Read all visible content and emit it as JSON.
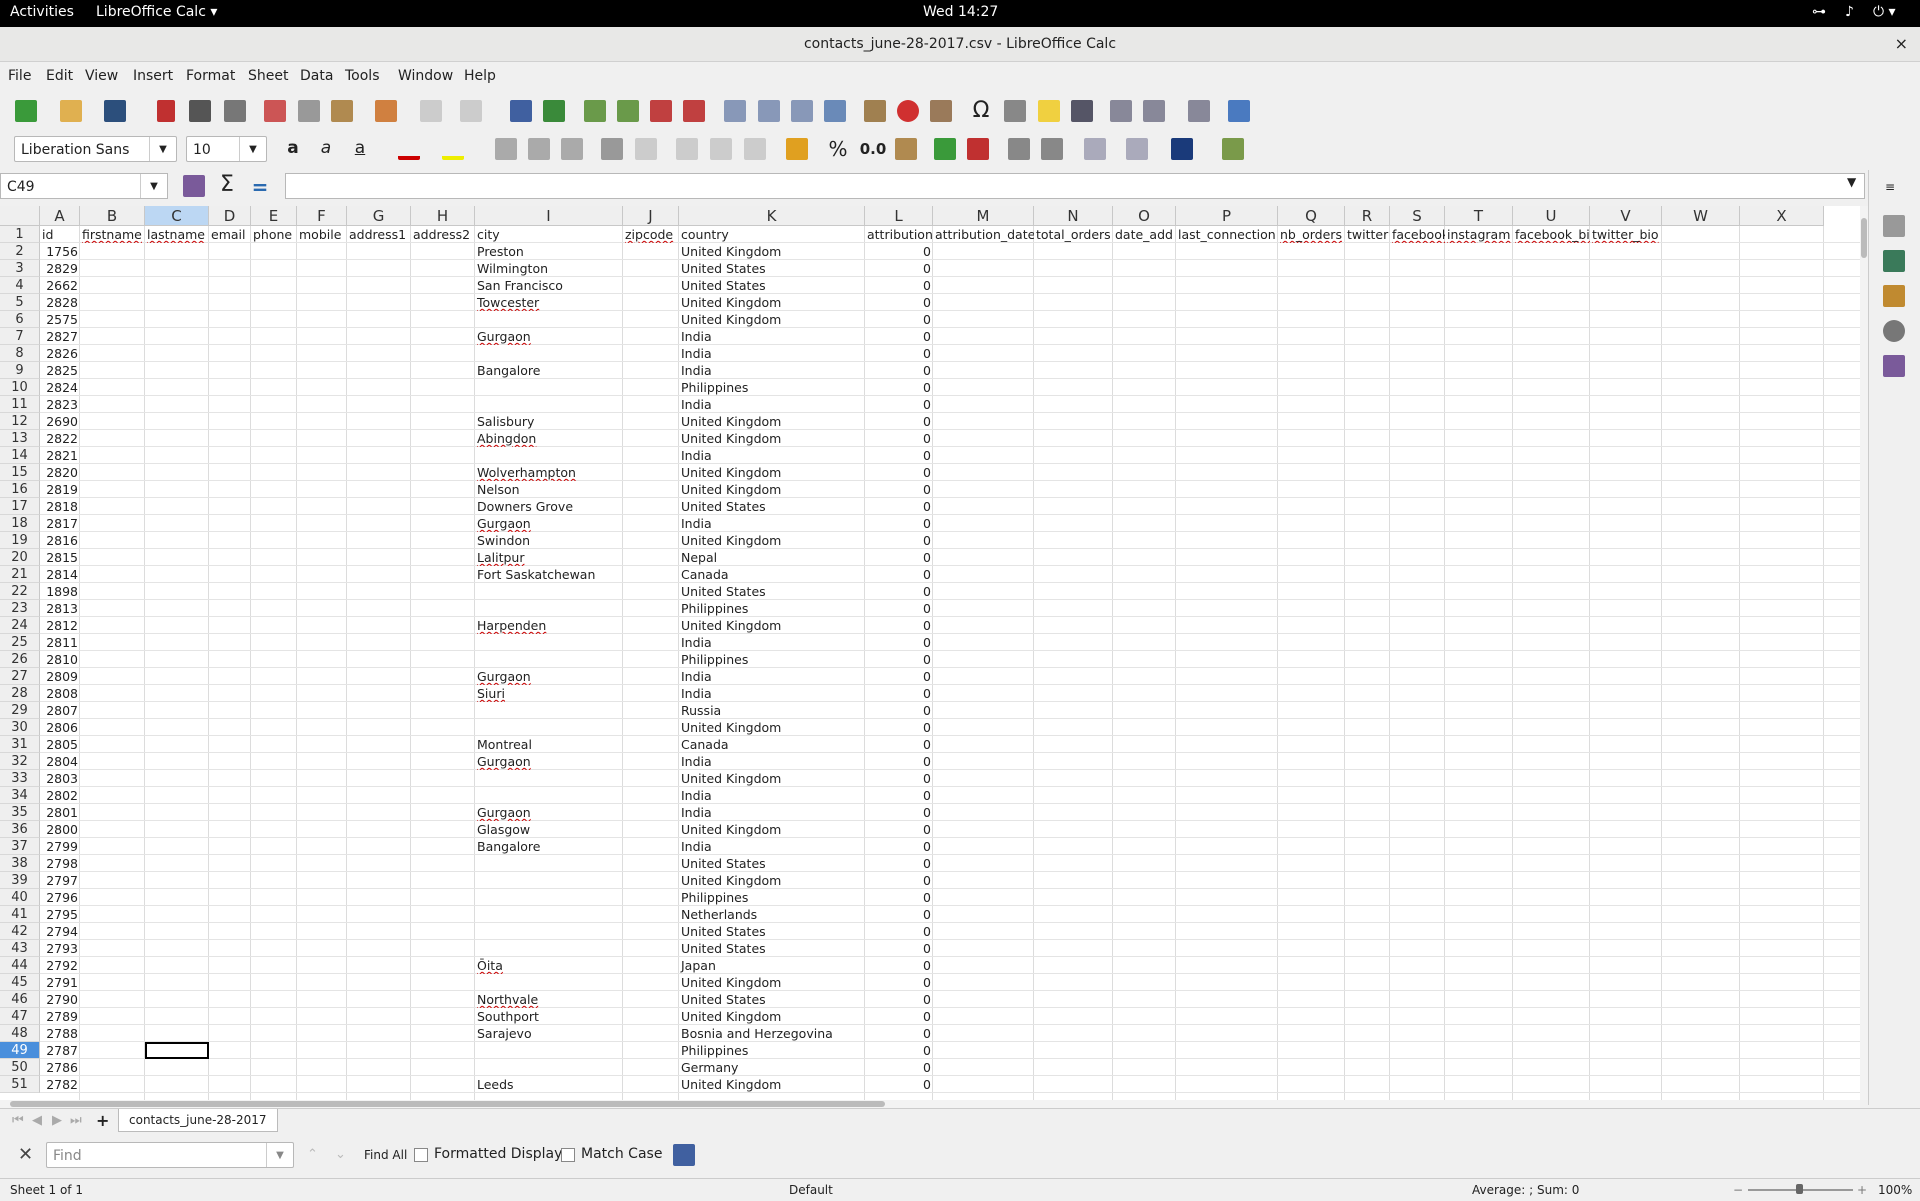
{
  "topbar": {
    "activities": "Activities",
    "app_menu": "LibreOffice Calc ▾",
    "clock": "Wed 14:27"
  },
  "window": {
    "title": "contacts_june-28-2017.csv - LibreOffice Calc",
    "close": "×"
  },
  "menu": [
    "File",
    "Edit",
    "View",
    "Insert",
    "Format",
    "Sheet",
    "Data",
    "Tools",
    "Window",
    "Help"
  ],
  "toolbar": {
    "font_name": "Liberation Sans",
    "font_size": "10",
    "percent": "%",
    "decimal": "0.0",
    "omega": "Ω"
  },
  "formula_bar": {
    "name_box": "C49",
    "formula": "",
    "sum_icon": "Σ",
    "equals_icon": "="
  },
  "columns": [
    {
      "letter": "A",
      "header": "id"
    },
    {
      "letter": "B",
      "header": "firstname"
    },
    {
      "letter": "C",
      "header": "lastname"
    },
    {
      "letter": "D",
      "header": "email"
    },
    {
      "letter": "E",
      "header": "phone"
    },
    {
      "letter": "F",
      "header": "mobile"
    },
    {
      "letter": "G",
      "header": "address1"
    },
    {
      "letter": "H",
      "header": "address2"
    },
    {
      "letter": "I",
      "header": "city"
    },
    {
      "letter": "J",
      "header": "zipcode"
    },
    {
      "letter": "K",
      "header": "country"
    },
    {
      "letter": "L",
      "header": "attribution"
    },
    {
      "letter": "M",
      "header": "attribution_date"
    },
    {
      "letter": "N",
      "header": "total_orders"
    },
    {
      "letter": "O",
      "header": "date_add"
    },
    {
      "letter": "P",
      "header": "last_connection"
    },
    {
      "letter": "Q",
      "header": "nb_orders"
    },
    {
      "letter": "R",
      "header": "twitter"
    },
    {
      "letter": "S",
      "header": "facebook"
    },
    {
      "letter": "T",
      "header": "instagram"
    },
    {
      "letter": "U",
      "header": "facebook_bio"
    },
    {
      "letter": "V",
      "header": "twitter_bio"
    },
    {
      "letter": "W",
      "header": ""
    },
    {
      "letter": "X",
      "header": ""
    }
  ],
  "rows": [
    {
      "n": "2",
      "id": "1756",
      "city": "Preston",
      "country": "United Kingdom",
      "attr": "0"
    },
    {
      "n": "3",
      "id": "2829",
      "city": "Wilmington",
      "country": "United States",
      "attr": "0"
    },
    {
      "n": "4",
      "id": "2662",
      "city": "San Francisco",
      "country": "United States",
      "attr": "0"
    },
    {
      "n": "5",
      "id": "2828",
      "city": "Towcester",
      "country": "United Kingdom",
      "attr": "0"
    },
    {
      "n": "6",
      "id": "2575",
      "city": "",
      "country": "United Kingdom",
      "attr": "0"
    },
    {
      "n": "7",
      "id": "2827",
      "city": "Gurgaon",
      "country": "India",
      "attr": "0"
    },
    {
      "n": "8",
      "id": "2826",
      "city": "",
      "country": "India",
      "attr": "0"
    },
    {
      "n": "9",
      "id": "2825",
      "city": "Bangalore",
      "country": "India",
      "attr": "0"
    },
    {
      "n": "10",
      "id": "2824",
      "city": "",
      "country": "Philippines",
      "attr": "0"
    },
    {
      "n": "11",
      "id": "2823",
      "city": "",
      "country": "India",
      "attr": "0"
    },
    {
      "n": "12",
      "id": "2690",
      "city": "Salisbury",
      "country": "United Kingdom",
      "attr": "0"
    },
    {
      "n": "13",
      "id": "2822",
      "city": "Abingdon",
      "country": "United Kingdom",
      "attr": "0"
    },
    {
      "n": "14",
      "id": "2821",
      "city": "",
      "country": "India",
      "attr": "0"
    },
    {
      "n": "15",
      "id": "2820",
      "city": "Wolverhampton",
      "country": "United Kingdom",
      "attr": "0"
    },
    {
      "n": "16",
      "id": "2819",
      "city": "Nelson",
      "country": "United Kingdom",
      "attr": "0"
    },
    {
      "n": "17",
      "id": "2818",
      "city": "Downers Grove",
      "country": "United States",
      "attr": "0"
    },
    {
      "n": "18",
      "id": "2817",
      "city": "Gurgaon",
      "country": "India",
      "attr": "0"
    },
    {
      "n": "19",
      "id": "2816",
      "city": "Swindon",
      "country": "United Kingdom",
      "attr": "0"
    },
    {
      "n": "20",
      "id": "2815",
      "city": "Lalitpur",
      "country": "Nepal",
      "attr": "0"
    },
    {
      "n": "21",
      "id": "2814",
      "city": "Fort Saskatchewan",
      "country": "Canada",
      "attr": "0"
    },
    {
      "n": "22",
      "id": "1898",
      "city": "",
      "country": "United States",
      "attr": "0"
    },
    {
      "n": "23",
      "id": "2813",
      "city": "",
      "country": "Philippines",
      "attr": "0"
    },
    {
      "n": "24",
      "id": "2812",
      "city": "Harpenden",
      "country": "United Kingdom",
      "attr": "0"
    },
    {
      "n": "25",
      "id": "2811",
      "city": "",
      "country": "India",
      "attr": "0"
    },
    {
      "n": "26",
      "id": "2810",
      "city": "",
      "country": "Philippines",
      "attr": "0"
    },
    {
      "n": "27",
      "id": "2809",
      "city": "Gurgaon",
      "country": "India",
      "attr": "0"
    },
    {
      "n": "28",
      "id": "2808",
      "city": "Siuri",
      "country": "India",
      "attr": "0"
    },
    {
      "n": "29",
      "id": "2807",
      "city": "",
      "country": "Russia",
      "attr": "0"
    },
    {
      "n": "30",
      "id": "2806",
      "city": "",
      "country": "United Kingdom",
      "attr": "0"
    },
    {
      "n": "31",
      "id": "2805",
      "city": "Montreal",
      "country": "Canada",
      "attr": "0"
    },
    {
      "n": "32",
      "id": "2804",
      "city": "Gurgaon",
      "country": "India",
      "attr": "0"
    },
    {
      "n": "33",
      "id": "2803",
      "city": "",
      "country": "United Kingdom",
      "attr": "0"
    },
    {
      "n": "34",
      "id": "2802",
      "city": "",
      "country": "India",
      "attr": "0"
    },
    {
      "n": "35",
      "id": "2801",
      "city": "Gurgaon",
      "country": "India",
      "attr": "0"
    },
    {
      "n": "36",
      "id": "2800",
      "city": "Glasgow",
      "country": "United Kingdom",
      "attr": "0"
    },
    {
      "n": "37",
      "id": "2799",
      "city": "Bangalore",
      "country": "India",
      "attr": "0"
    },
    {
      "n": "38",
      "id": "2798",
      "city": "",
      "country": "United States",
      "attr": "0"
    },
    {
      "n": "39",
      "id": "2797",
      "city": "",
      "country": "United Kingdom",
      "attr": "0"
    },
    {
      "n": "40",
      "id": "2796",
      "city": "",
      "country": "Philippines",
      "attr": "0"
    },
    {
      "n": "41",
      "id": "2795",
      "city": "",
      "country": "Netherlands",
      "attr": "0"
    },
    {
      "n": "42",
      "id": "2794",
      "city": "",
      "country": "United States",
      "attr": "0"
    },
    {
      "n": "43",
      "id": "2793",
      "city": "",
      "country": "United States",
      "attr": "0"
    },
    {
      "n": "44",
      "id": "2792",
      "city": "Ōita",
      "country": "Japan",
      "attr": "0"
    },
    {
      "n": "45",
      "id": "2791",
      "city": "",
      "country": "United Kingdom",
      "attr": "0"
    },
    {
      "n": "46",
      "id": "2790",
      "city": "Northvale",
      "country": "United States",
      "attr": "0"
    },
    {
      "n": "47",
      "id": "2789",
      "city": "Southport",
      "country": "United Kingdom",
      "attr": "0"
    },
    {
      "n": "48",
      "id": "2788",
      "city": "Sarajevo",
      "country": "Bosnia and Herzegovina",
      "attr": "0"
    },
    {
      "n": "49",
      "id": "2787",
      "city": "",
      "country": "Philippines",
      "attr": "0"
    },
    {
      "n": "50",
      "id": "2786",
      "city": "",
      "country": "Germany",
      "attr": "0"
    },
    {
      "n": "51",
      "id": "2782",
      "city": "Leeds",
      "country": "United Kingdom",
      "attr": "0"
    }
  ],
  "spell_flagged": [
    "Towcester",
    "Gurgaon",
    "Abingdon",
    "Wolverhampton",
    "Lalitpur",
    "Harpenden",
    "Siuri",
    "Ōita",
    "Northvale",
    "firstname",
    "lastname",
    "zipcode",
    "nb_orders",
    "facebook",
    "instagram",
    "facebook_bio",
    "twitter_bio"
  ],
  "selected": {
    "column": "C",
    "row": "49"
  },
  "sheet_tab": "contacts_june-28-2017",
  "findbar": {
    "placeholder": "Find",
    "find_all": "Find All",
    "formatted_display": "Formatted Display",
    "match_case": "Match Case"
  },
  "status": {
    "sheet": "Sheet 1 of 1",
    "style": "Default",
    "summary": "Average: ; Sum: 0",
    "zoom": "100%"
  },
  "colors": {
    "selection_header": "#bcd7f3",
    "selected_row": "#4a8fdc",
    "spell": "#cc0000"
  }
}
